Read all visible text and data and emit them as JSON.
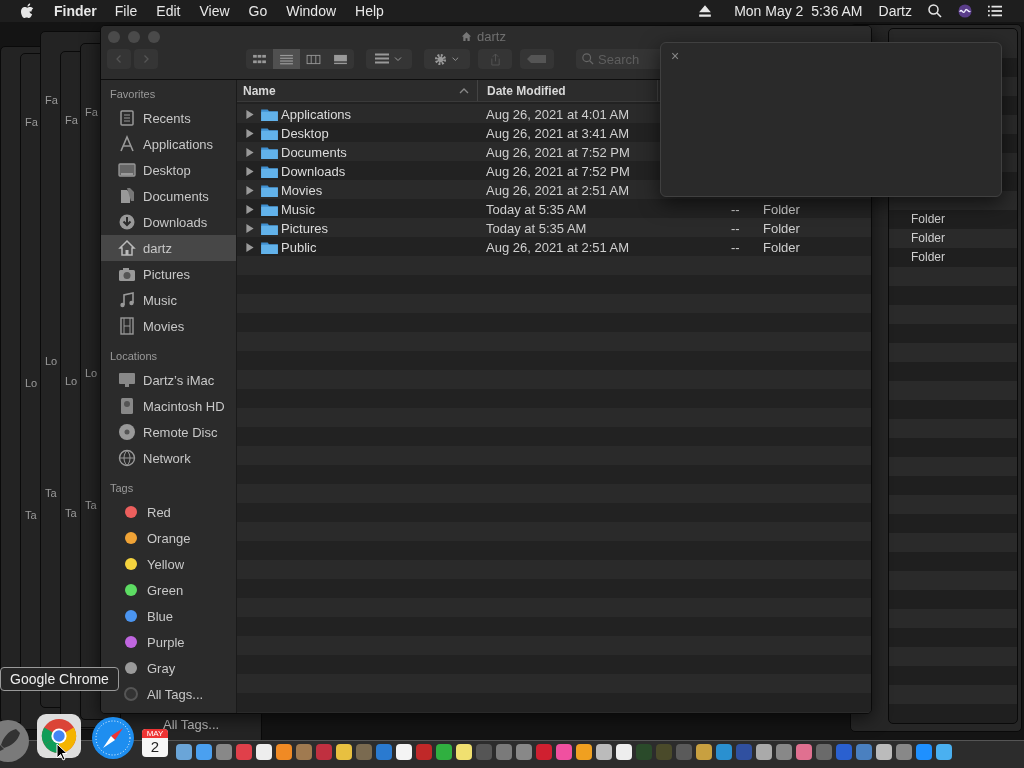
{
  "menu_bar": {
    "app": "Finder",
    "menus": [
      "File",
      "Edit",
      "View",
      "Go",
      "Window",
      "Help"
    ],
    "clock": "Mon May 2  5:36 AM",
    "user": "Dartz"
  },
  "background_windows": [
    {
      "labels": [
        "Fa",
        "Lo",
        "Ta"
      ]
    },
    {
      "labels": [
        "Fa",
        "Lo",
        "Ta"
      ]
    },
    {
      "labels": [
        "Fa",
        "Lo",
        "Ta"
      ]
    },
    {
      "labels": [
        "Fa",
        "Lo",
        "Ta"
      ]
    }
  ],
  "lower_window": {
    "label": "All Tags..."
  },
  "right_window": {
    "kinds": [
      "Folder",
      "Folder",
      "Folder"
    ]
  },
  "finder": {
    "title": "dartz",
    "view_modes": [
      {
        "kind": "icon",
        "selected": false
      },
      {
        "kind": "list",
        "selected": true
      },
      {
        "kind": "column",
        "selected": false
      },
      {
        "kind": "gallery",
        "selected": false
      }
    ],
    "search": {
      "placeholder": "Search"
    },
    "sidebar": [
      {
        "heading": "Favorites",
        "items": [
          {
            "label": "Recents",
            "selected": false
          },
          {
            "label": "Applications",
            "selected": false
          },
          {
            "label": "Desktop",
            "selected": false
          },
          {
            "label": "Documents",
            "selected": false
          },
          {
            "label": "Downloads",
            "selected": false
          },
          {
            "label": "dartz",
            "selected": true
          },
          {
            "label": "Pictures",
            "selected": false
          },
          {
            "label": "Music",
            "selected": false
          },
          {
            "label": "Movies",
            "selected": false
          }
        ]
      },
      {
        "heading": "Locations",
        "items": [
          {
            "label": "Dartz’s iMac",
            "selected": false
          },
          {
            "label": "Macintosh HD",
            "selected": false
          },
          {
            "label": "Remote Disc",
            "selected": false
          },
          {
            "label": "Network",
            "selected": false
          }
        ]
      },
      {
        "heading": "Tags",
        "items": [
          {
            "kind": "tag",
            "label": "Red",
            "color": "#ec5f5d",
            "selected": false
          },
          {
            "kind": "tag",
            "label": "Orange",
            "color": "#f0a336",
            "selected": false
          },
          {
            "kind": "tag",
            "label": "Yellow",
            "color": "#f5d33e",
            "selected": false
          },
          {
            "kind": "tag",
            "label": "Green",
            "color": "#5ddc63",
            "selected": false
          },
          {
            "kind": "tag",
            "label": "Blue",
            "color": "#4b95f0",
            "selected": false
          },
          {
            "kind": "tag",
            "label": "Purple",
            "color": "#c066e0",
            "selected": false
          },
          {
            "kind": "tag",
            "label": "Gray",
            "color": "#9a9a9a",
            "selected": false
          },
          {
            "kind": "all",
            "label": "All Tags...",
            "selected": false
          }
        ]
      }
    ],
    "columns": [
      {
        "label": "Name",
        "sorted": true
      },
      {
        "label": "Date Modified",
        "sorted": false
      }
    ],
    "rows": [
      {
        "name": "Applications",
        "date": "Aug 26, 2021 at 4:01 AM"
      },
      {
        "name": "Desktop",
        "date": "Aug 26, 2021 at 3:41 AM"
      },
      {
        "name": "Documents",
        "date": "Aug 26, 2021 at 7:52 PM"
      },
      {
        "name": "Downloads",
        "date": "Aug 26, 2021 at 7:52 PM"
      },
      {
        "name": "Movies",
        "date": "Aug 26, 2021 at 2:51 AM"
      },
      {
        "name": "Music",
        "date": "Today at 5:35 AM",
        "size": "--",
        "kind": "Folder"
      },
      {
        "name": "Pictures",
        "date": "Today at 5:35 AM",
        "size": "--",
        "kind": "Folder"
      },
      {
        "name": "Public",
        "date": "Aug 26, 2021 at 2:51 AM",
        "size": "--",
        "kind": "Folder"
      }
    ]
  },
  "popup": {
    "close": "×"
  },
  "tooltip": {
    "text": "Google Chrome"
  },
  "dock": {
    "calendar": {
      "month": "MAY",
      "day": "2"
    }
  }
}
